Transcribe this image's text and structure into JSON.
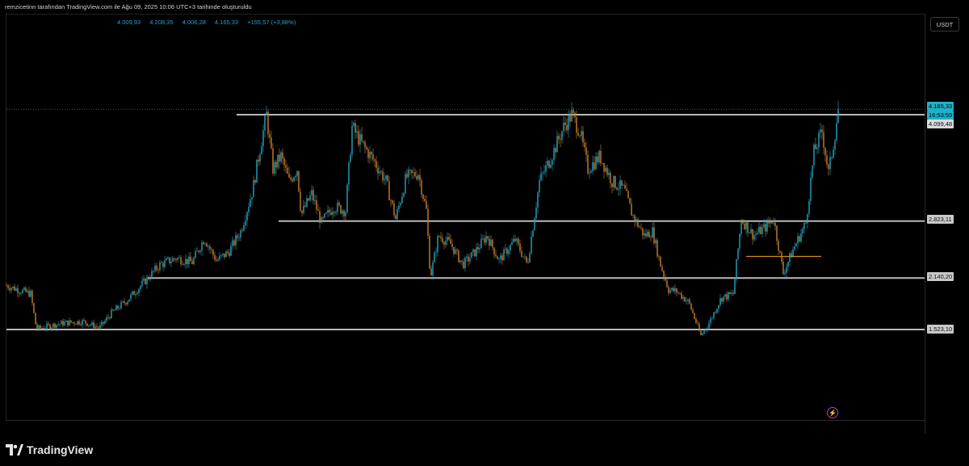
{
  "caption": "remzicetinn tarafından TradingView.com ile Ağu 09, 2025 10:06 UTC+3 tarihinde oluşturuldu",
  "ohlc": {
    "open": "4.009,93",
    "high": "4.208,35",
    "low": "4.006,28",
    "close": "4.165,33",
    "change": "+155,57 (+3,88%)"
  },
  "currency": "USDT",
  "axis_labels": {
    "last_price": "4.165,33",
    "countdown": "16:53:59",
    "level_top": "4.099,48",
    "level_2": "2.823,11",
    "level_3": "2.140,20",
    "level_4": "1.523,10"
  },
  "brand": "TradingView",
  "colors": {
    "bull": "#26a6c3",
    "bear": "#c8812f",
    "level_line": "#b8b8b8",
    "accent_line": "#d9881e",
    "last_price_line": "#1fb1c9"
  },
  "chart_data": {
    "type": "candlestick",
    "title": "",
    "xlabel": "",
    "ylabel": "",
    "ylim": [
      1100,
      4500
    ],
    "grid": false,
    "horizontal_levels": [
      4099.48,
      2823.11,
      2140.2,
      1523.1
    ],
    "sub_level": 2400,
    "last_price": 4165.33,
    "series": [
      {
        "points": [
          [
            0,
            2050
          ],
          [
            30,
            1950
          ],
          [
            37,
            1530
          ],
          [
            70,
            1600
          ],
          [
            95,
            1620
          ],
          [
            115,
            1540
          ],
          [
            130,
            1720
          ],
          [
            150,
            1880
          ],
          [
            175,
            2140
          ],
          [
            190,
            2300
          ],
          [
            210,
            2380
          ],
          [
            230,
            2330
          ],
          [
            245,
            2620
          ],
          [
            260,
            2350
          ],
          [
            275,
            2450
          ],
          [
            290,
            2700
          ],
          [
            305,
            3200
          ],
          [
            315,
            3750
          ],
          [
            322,
            4100
          ],
          [
            330,
            3450
          ],
          [
            340,
            3600
          ],
          [
            350,
            3300
          ],
          [
            360,
            3450
          ],
          [
            365,
            2900
          ],
          [
            378,
            3150
          ],
          [
            390,
            2800
          ],
          [
            405,
            3000
          ],
          [
            420,
            2950
          ],
          [
            428,
            3950
          ],
          [
            440,
            3750
          ],
          [
            455,
            3550
          ],
          [
            470,
            3300
          ],
          [
            482,
            2850
          ],
          [
            495,
            3350
          ],
          [
            510,
            3400
          ],
          [
            520,
            2950
          ],
          [
            525,
            2150
          ],
          [
            535,
            2650
          ],
          [
            550,
            2550
          ],
          [
            565,
            2300
          ],
          [
            580,
            2450
          ],
          [
            595,
            2650
          ],
          [
            610,
            2350
          ],
          [
            630,
            2600
          ],
          [
            645,
            2300
          ],
          [
            660,
            3300
          ],
          [
            675,
            3600
          ],
          [
            690,
            3950
          ],
          [
            700,
            4100
          ],
          [
            710,
            3900
          ],
          [
            720,
            3450
          ],
          [
            735,
            3600
          ],
          [
            750,
            3300
          ],
          [
            765,
            3200
          ],
          [
            775,
            2900
          ],
          [
            790,
            2650
          ],
          [
            800,
            2700
          ],
          [
            810,
            2300
          ],
          [
            820,
            2000
          ],
          [
            830,
            1980
          ],
          [
            845,
            1850
          ],
          [
            860,
            1450
          ],
          [
            870,
            1600
          ],
          [
            885,
            1900
          ],
          [
            900,
            1950
          ],
          [
            910,
            2850
          ],
          [
            925,
            2650
          ],
          [
            940,
            2750
          ],
          [
            950,
            2850
          ],
          [
            962,
            2200
          ],
          [
            975,
            2500
          ],
          [
            990,
            2800
          ],
          [
            1000,
            3650
          ],
          [
            1010,
            3900
          ],
          [
            1018,
            3400
          ],
          [
            1025,
            3800
          ],
          [
            1030,
            4165
          ]
        ]
      }
    ]
  }
}
